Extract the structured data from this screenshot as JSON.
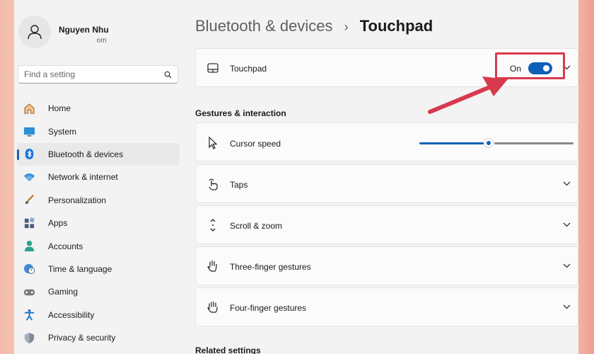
{
  "profile": {
    "name": "Nguyen Nhu",
    "email": "                  om"
  },
  "search": {
    "placeholder": "Find a setting"
  },
  "sidebar": {
    "items": [
      {
        "label": "Home",
        "icon": "home-icon"
      },
      {
        "label": "System",
        "icon": "monitor-icon"
      },
      {
        "label": "Bluetooth & devices",
        "icon": "bluetooth-icon",
        "active": true
      },
      {
        "label": "Network & internet",
        "icon": "wifi-icon"
      },
      {
        "label": "Personalization",
        "icon": "brush-icon"
      },
      {
        "label": "Apps",
        "icon": "apps-icon"
      },
      {
        "label": "Accounts",
        "icon": "accounts-icon"
      },
      {
        "label": "Time & language",
        "icon": "globe-clock-icon"
      },
      {
        "label": "Gaming",
        "icon": "gamepad-icon"
      },
      {
        "label": "Accessibility",
        "icon": "accessibility-icon"
      },
      {
        "label": "Privacy & security",
        "icon": "shield-icon"
      }
    ]
  },
  "breadcrumb": {
    "parent": "Bluetooth & devices",
    "separator": "›",
    "current": "Touchpad"
  },
  "touchpad": {
    "label": "Touchpad",
    "toggle_text": "On",
    "toggle_on": true
  },
  "gestures": {
    "section_title": "Gestures & interaction",
    "cursor_speed": {
      "label": "Cursor speed",
      "value_fraction": 0.45
    },
    "taps": "Taps",
    "scroll_zoom": "Scroll & zoom",
    "three_finger": "Three-finger gestures",
    "four_finger": "Four-finger gestures"
  },
  "related": {
    "section_title": "Related settings"
  },
  "colors": {
    "accent": "#0f5fb8",
    "highlight": "#d83a4d"
  }
}
